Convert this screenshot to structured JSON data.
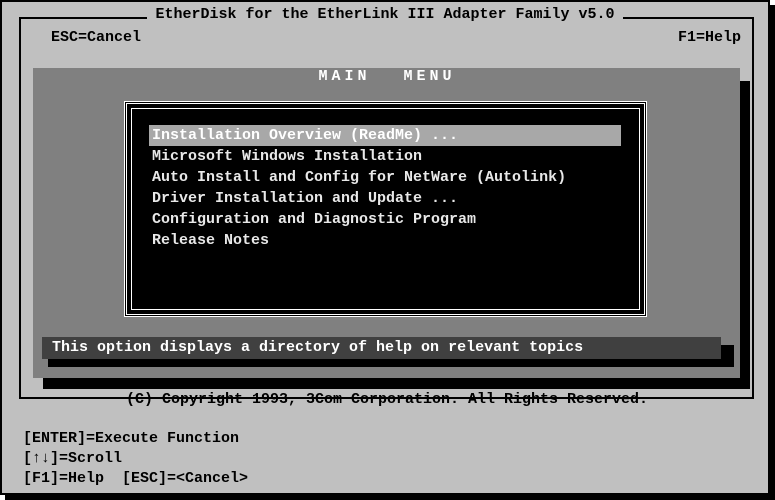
{
  "window": {
    "title": "EtherDisk for the EtherLink III Adapter Family v5.0",
    "esc_label": "ESC=Cancel",
    "f1_label": "F1=Help"
  },
  "menu": {
    "heading": "MAIN MENU",
    "items": [
      {
        "label": "Installation Overview (ReadMe) ...",
        "selected": true
      },
      {
        "label": "Microsoft Windows Installation",
        "selected": false
      },
      {
        "label": "Auto Install and Config for NetWare (Autolink)",
        "selected": false
      },
      {
        "label": "Driver Installation and Update ...",
        "selected": false
      },
      {
        "label": "Configuration and Diagnostic Program",
        "selected": false
      },
      {
        "label": "Release Notes",
        "selected": false
      }
    ]
  },
  "status": {
    "description": "This option displays a directory of help on relevant topics"
  },
  "copyright": "(C) Copyright 1993, 3Com Corporation. All Rights Reserved.",
  "keys": {
    "enter": "[ENTER]=Execute Function",
    "scroll": "[↑↓]=Scroll",
    "help_cancel": "[F1]=Help  [ESC]=<Cancel>"
  },
  "colors": {
    "screen_bg": "#c0c0c0",
    "panel_bg": "#808080",
    "menu_bg": "#000000",
    "highlight_bg": "#a8a8a8",
    "status_bg": "#404040"
  }
}
